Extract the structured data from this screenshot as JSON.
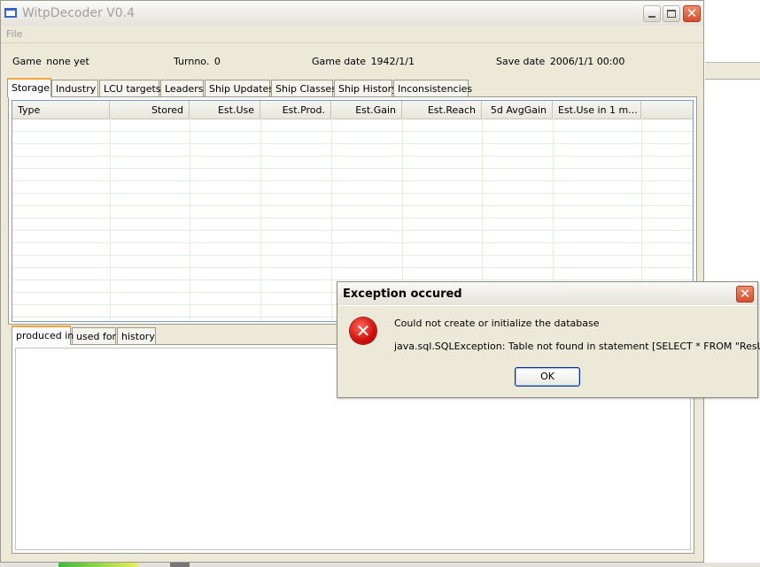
{
  "window": {
    "title": "WitpDecoder V0.4",
    "icon": "app-window-icon"
  },
  "menu": {
    "file": "File"
  },
  "info": {
    "game_label": "Game",
    "game_value": "none yet",
    "turn_label": "Turnno.",
    "turn_value": "0",
    "gamedate_label": "Game date",
    "gamedate_value": "1942/1/1",
    "savedate_label": "Save date",
    "savedate_value": "2006/1/1 00:00"
  },
  "tabs": [
    "Storage",
    "Industry",
    "LCU targets",
    "Leaders",
    "Ship Updates",
    "Ship Classes",
    "Ship History",
    "Inconsistencies"
  ],
  "table": {
    "columns": [
      "Type",
      "Stored",
      "Est.Use",
      "Est.Prod.",
      "Est.Gain",
      "Est.Reach",
      "5d AvgGain",
      "Est.Use in 1 m..."
    ]
  },
  "bottom_tabs": [
    "produced in",
    "used for",
    "history"
  ],
  "dialog": {
    "title": "Exception occured",
    "message": "Could not create or initialize the database",
    "detail": "java.sql.SQLException: Table not found in statement [SELECT * FROM \"ResUsage\"]",
    "ok_label": "OK",
    "close_glyph": "✕",
    "error_glyph": "✕"
  },
  "colors": {
    "accent_tab": "#f3a63b",
    "close_red": "#d2502c",
    "error_red": "#d00e0e",
    "grid_line": "#e3efdc"
  }
}
